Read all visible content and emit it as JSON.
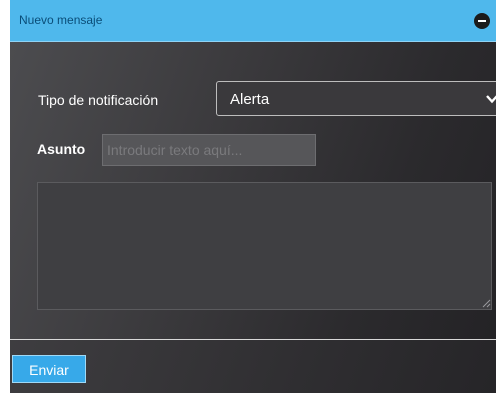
{
  "header": {
    "title": "Nuevo mensaje",
    "collapse_icon": "minus-circle-icon"
  },
  "form": {
    "notification_type_label": "Tipo de notificación",
    "notification_type_value": "Alerta",
    "subject_label": "Asunto",
    "subject_placeholder": "Introducir texto aquí...",
    "subject_value": "",
    "message_value": ""
  },
  "footer": {
    "send_label": "Enviar"
  },
  "colors": {
    "header_bg": "#4fb8ec",
    "send_button_bg": "#37a9e9"
  }
}
